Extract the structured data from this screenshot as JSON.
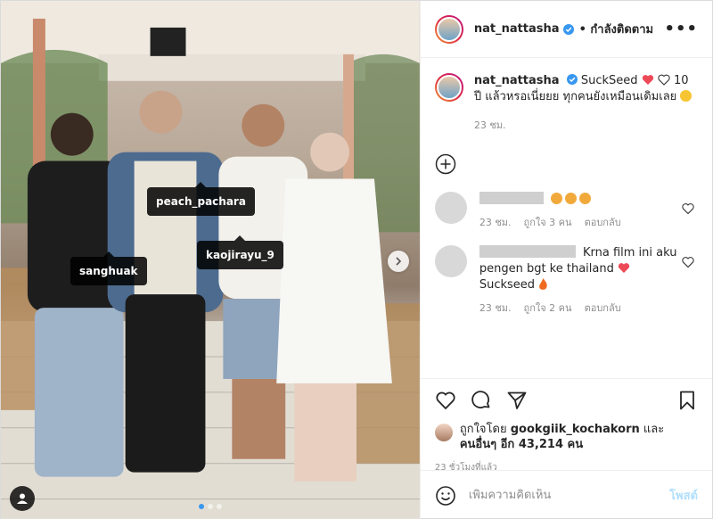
{
  "header": {
    "username": "nat_nattasha",
    "follow_label": "• กำลังติดตาม",
    "more_label": "•••"
  },
  "photo": {
    "tags": [
      "peach_pachara",
      "kaojirayu_9",
      "sanghuak"
    ],
    "slide_count": 3,
    "active_slide": 1
  },
  "caption": {
    "username": "nat_nattasha",
    "text_part1": "SuckSeed",
    "text_part2": "10 ปี แล้วหรอเนี่ยยย ทุกคนยังเหมือนเดิมเลย",
    "time": "23 ชม."
  },
  "comments": [
    {
      "text": "",
      "time": "23 ชม.",
      "likes": "ถูกใจ 3 คน",
      "reply": "ตอบกลับ"
    },
    {
      "text": "Krna film ini aku pengen bgt ke thailand",
      "text2": "Suckseed",
      "time": "23 ชม.",
      "likes": "ถูกใจ 2 คน",
      "reply": "ตอบกลับ"
    }
  ],
  "likes": {
    "prefix": "ถูกใจโดย",
    "user": "gookgiik_kochakorn",
    "joiner": "และ",
    "others": "คนอื่นๆ อีก 43,214 คน"
  },
  "timestamp": "23 ชั่วโมงที่แล้ว",
  "add_comment": {
    "placeholder": "เพิ่มความคิดเห็น",
    "post_label": "โพสต์"
  },
  "colors": {
    "verified": "#3897f0",
    "heart_red": "#ed4956",
    "post_disabled": "#b2dffc"
  }
}
